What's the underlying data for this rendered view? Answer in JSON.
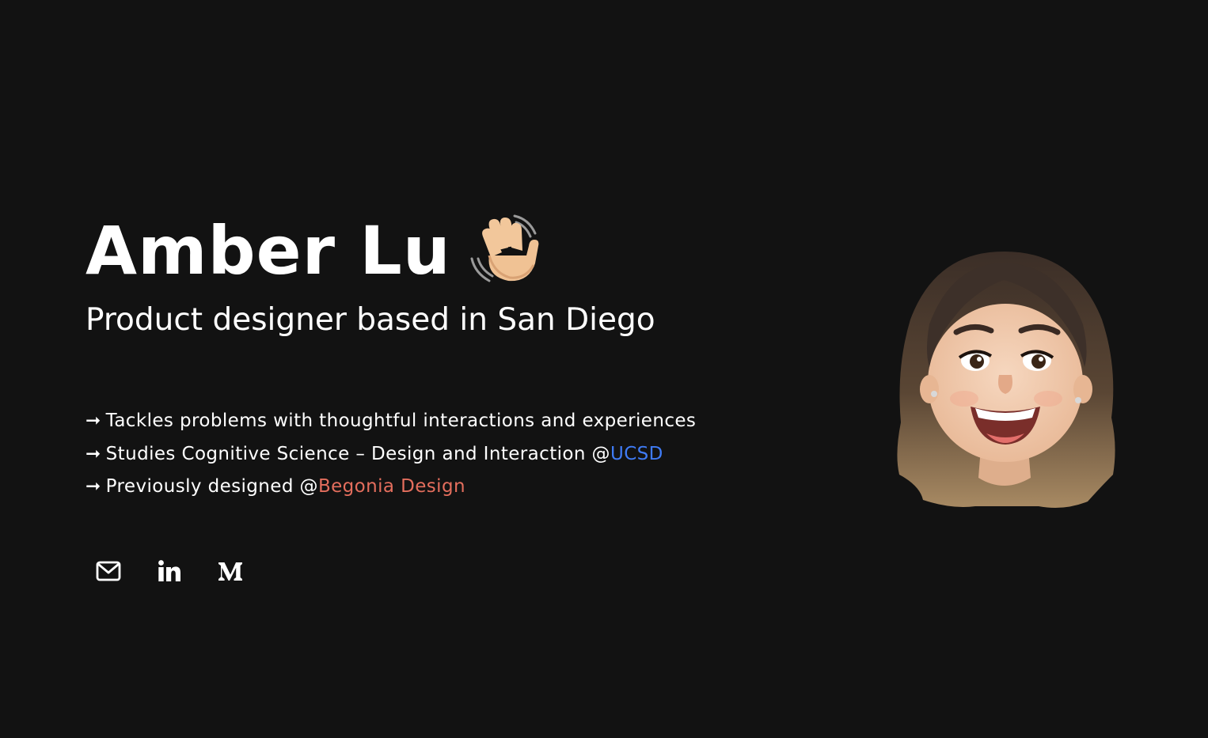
{
  "hero": {
    "name": "Amber Lu",
    "wave_icon": "waving-hand-emoji",
    "subtitle": "Product designer based in San Diego"
  },
  "bullets": [
    {
      "arrow": "➞",
      "text": "Tackles problems with thoughtful interactions and experiences"
    },
    {
      "arrow": "➞",
      "text": "Studies Cognitive Science – Design and Interaction @",
      "link_text": "UCSD",
      "link_color": "#3f7bf5"
    },
    {
      "arrow": "➞",
      "text": "Previously designed @",
      "link_text": "Begonia Design",
      "link_color": "#e46e5d"
    }
  ],
  "socials": [
    {
      "icon": "mail-icon"
    },
    {
      "icon": "linkedin-icon"
    },
    {
      "icon": "medium-icon"
    }
  ],
  "avatar": {
    "icon": "memoji-avatar"
  },
  "colors": {
    "background": "#121212",
    "text": "#ffffff",
    "ucsd_link": "#3f7bf5",
    "begonia_link": "#e46e5d"
  }
}
